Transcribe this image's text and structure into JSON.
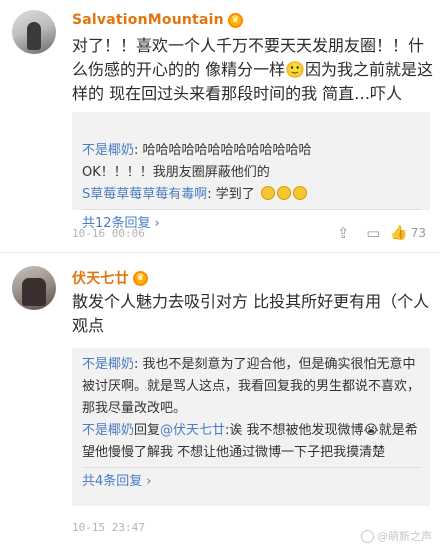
{
  "comments": [
    {
      "username": "SalvationMountain",
      "badge": "♛",
      "text": "对了！！喜欢一个人千万不要天天发朋友圈！！什么伤感的开心的的 像精分一样🙂因为我之前就是这样的 现在回过头来看那段时间的我 简直…吓人",
      "replies": [
        {
          "name": "不是椰奶",
          "text": ": 哈哈哈哈哈哈哈哈哈哈哈哈哈\nOK！！！！我朋友圈屏蔽他们的"
        },
        {
          "name": "S草莓草莓草莓有毒啊",
          "text": ": 学到了"
        }
      ],
      "more": "共12条回复",
      "time": "10-16 00:06",
      "likes": "73"
    },
    {
      "username": "伏天七廿",
      "badge": "♛",
      "text": "散发个人魅力去吸引对方 比投其所好更有用（个人观点",
      "replies": [
        {
          "name": "不是椰奶",
          "text": ": 我也不是刻意为了迎合他，但是确实很怕无意中被讨厌啊。就是骂人这点，我看回复我的男生都说不喜欢，那我尽量改改吧。"
        },
        {
          "name": "不是椰奶",
          "mid": "回复",
          "name2": "@伏天七廿",
          "text": ":诶 我不想被他发现微博😭就是希望他慢慢了解我 不想让他通过微博一下子把我摸清楚"
        }
      ],
      "more": "共4条回复",
      "time": "10-15 23:47",
      "likes": ""
    }
  ],
  "watermark": "@萌新之声"
}
